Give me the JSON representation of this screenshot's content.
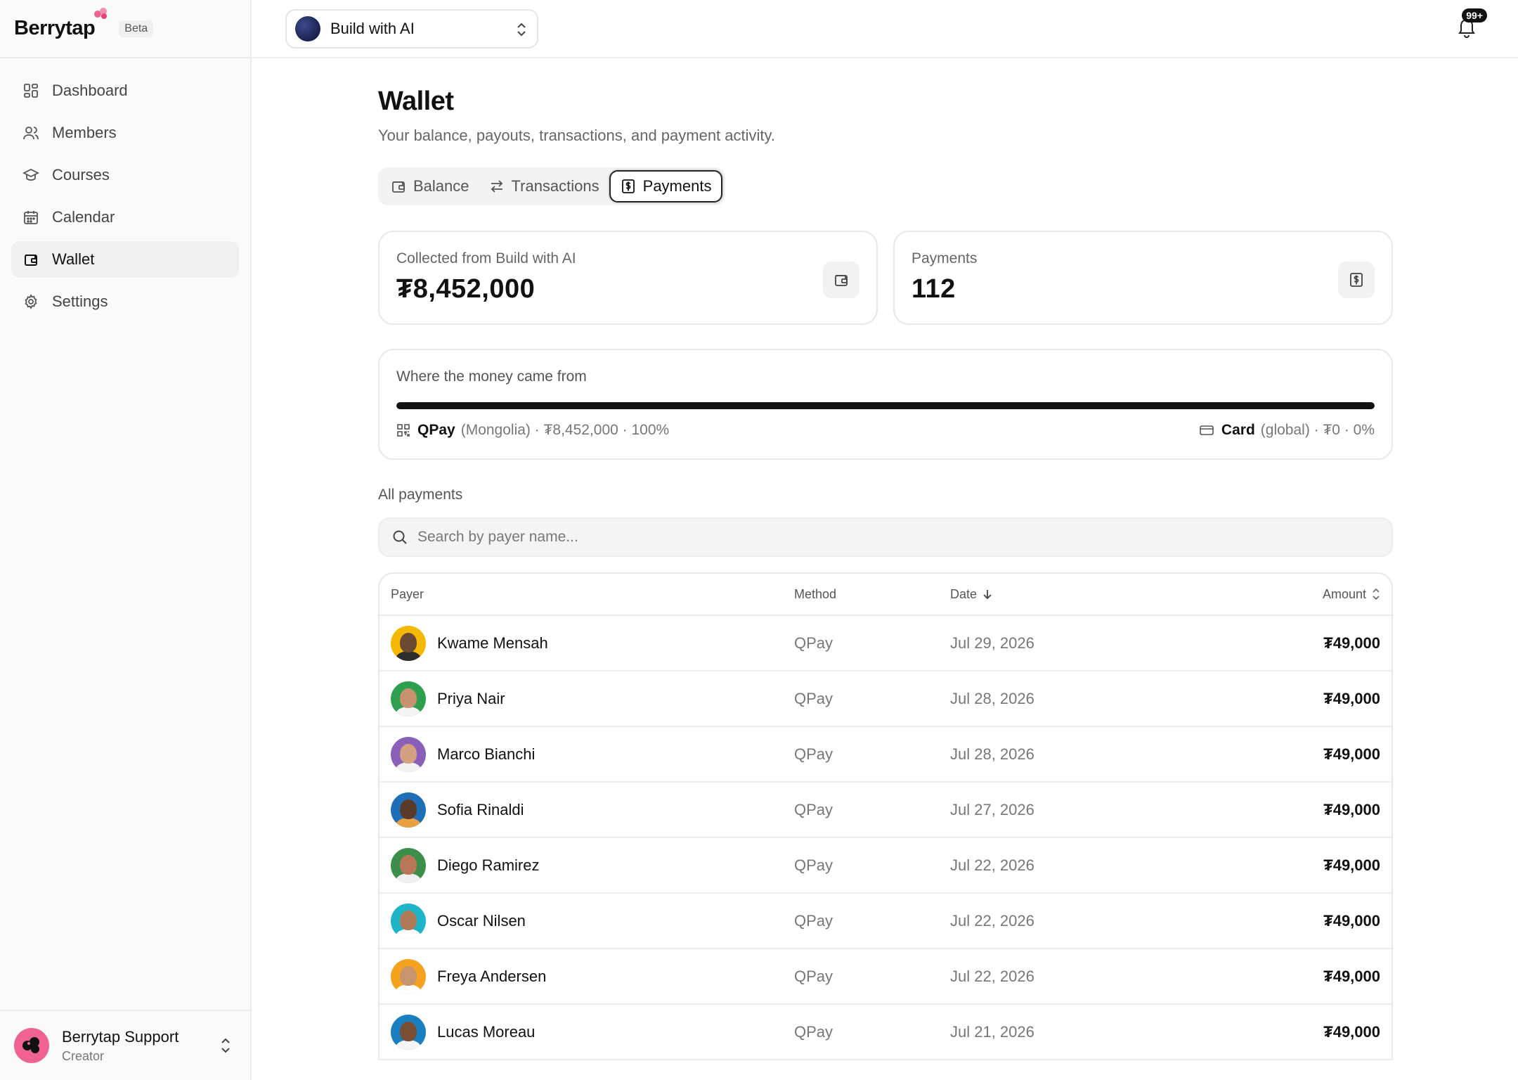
{
  "brand": {
    "name": "Berrytap",
    "badge": "Beta"
  },
  "sidebar": {
    "items": [
      {
        "label": "Dashboard",
        "icon": "dashboard-icon"
      },
      {
        "label": "Members",
        "icon": "members-icon"
      },
      {
        "label": "Courses",
        "icon": "graduation-cap-icon"
      },
      {
        "label": "Calendar",
        "icon": "calendar-icon"
      },
      {
        "label": "Wallet",
        "icon": "wallet-icon",
        "active": true
      },
      {
        "label": "Settings",
        "icon": "gear-icon"
      }
    ],
    "user": {
      "name": "Berrytap Support",
      "role": "Creator"
    }
  },
  "topbar": {
    "workspace": "Build with AI",
    "notifications": "99+"
  },
  "page": {
    "title": "Wallet",
    "subtitle": "Your balance, payouts, transactions, and payment activity."
  },
  "tabs": [
    {
      "label": "Balance",
      "icon": "wallet-icon"
    },
    {
      "label": "Transactions",
      "icon": "arrows-swap-icon"
    },
    {
      "label": "Payments",
      "icon": "dollar-receipt-icon",
      "active": true
    }
  ],
  "stats": {
    "collected": {
      "label": "Collected from Build with AI",
      "value": "₮8,452,000"
    },
    "payments": {
      "label": "Payments",
      "value": "112"
    }
  },
  "sources": {
    "label": "Where the money came from",
    "qpay_share": 1.0,
    "qpay": {
      "name": "QPay",
      "detail": "(Mongolia) · ₮8,452,000 · 100%"
    },
    "card": {
      "name": "Card",
      "detail": "(global) · ₮0 · 0%"
    }
  },
  "payments": {
    "section_label": "All payments",
    "search_placeholder": "Search by payer name...",
    "columns": {
      "payer": "Payer",
      "method": "Method",
      "date": "Date",
      "amount": "Amount"
    },
    "rows": [
      {
        "payer": "Kwame Mensah",
        "method": "QPay",
        "date": "Jul 29, 2026",
        "amount": "₮49,000",
        "avatar_bg": "#f5b800",
        "skin": "#6b4a35",
        "shirt": "#2d2d2d"
      },
      {
        "payer": "Priya Nair",
        "method": "QPay",
        "date": "Jul 28, 2026",
        "amount": "₮49,000",
        "avatar_bg": "#2e9e4f",
        "skin": "#c89270",
        "shirt": "#f4f4f4"
      },
      {
        "payer": "Marco Bianchi",
        "method": "QPay",
        "date": "Jul 28, 2026",
        "amount": "₮49,000",
        "avatar_bg": "#8a5fb8",
        "skin": "#d4a07f",
        "shirt": "#f2f2f2"
      },
      {
        "payer": "Sofia Rinaldi",
        "method": "QPay",
        "date": "Jul 27, 2026",
        "amount": "₮49,000",
        "avatar_bg": "#1f6fb8",
        "skin": "#5a3a28",
        "shirt": "#e8a040"
      },
      {
        "payer": "Diego Ramirez",
        "method": "QPay",
        "date": "Jul 22, 2026",
        "amount": "₮49,000",
        "avatar_bg": "#3c8f4a",
        "skin": "#b87858",
        "shirt": "#f0f0f0"
      },
      {
        "payer": "Oscar Nilsen",
        "method": "QPay",
        "date": "Jul 22, 2026",
        "amount": "₮49,000",
        "avatar_bg": "#1fb5c8",
        "skin": "#b07a58",
        "shirt": "#ffffff"
      },
      {
        "payer": "Freya Andersen",
        "method": "QPay",
        "date": "Jul 22, 2026",
        "amount": "₮49,000",
        "avatar_bg": "#f5a21e",
        "skin": "#c8946e",
        "shirt": "#ffffff"
      },
      {
        "payer": "Lucas Moreau",
        "method": "QPay",
        "date": "Jul 21, 2026",
        "amount": "₮49,000",
        "avatar_bg": "#1a7fc0",
        "skin": "#7a4e35",
        "shirt": "#f5f5f5"
      }
    ]
  }
}
